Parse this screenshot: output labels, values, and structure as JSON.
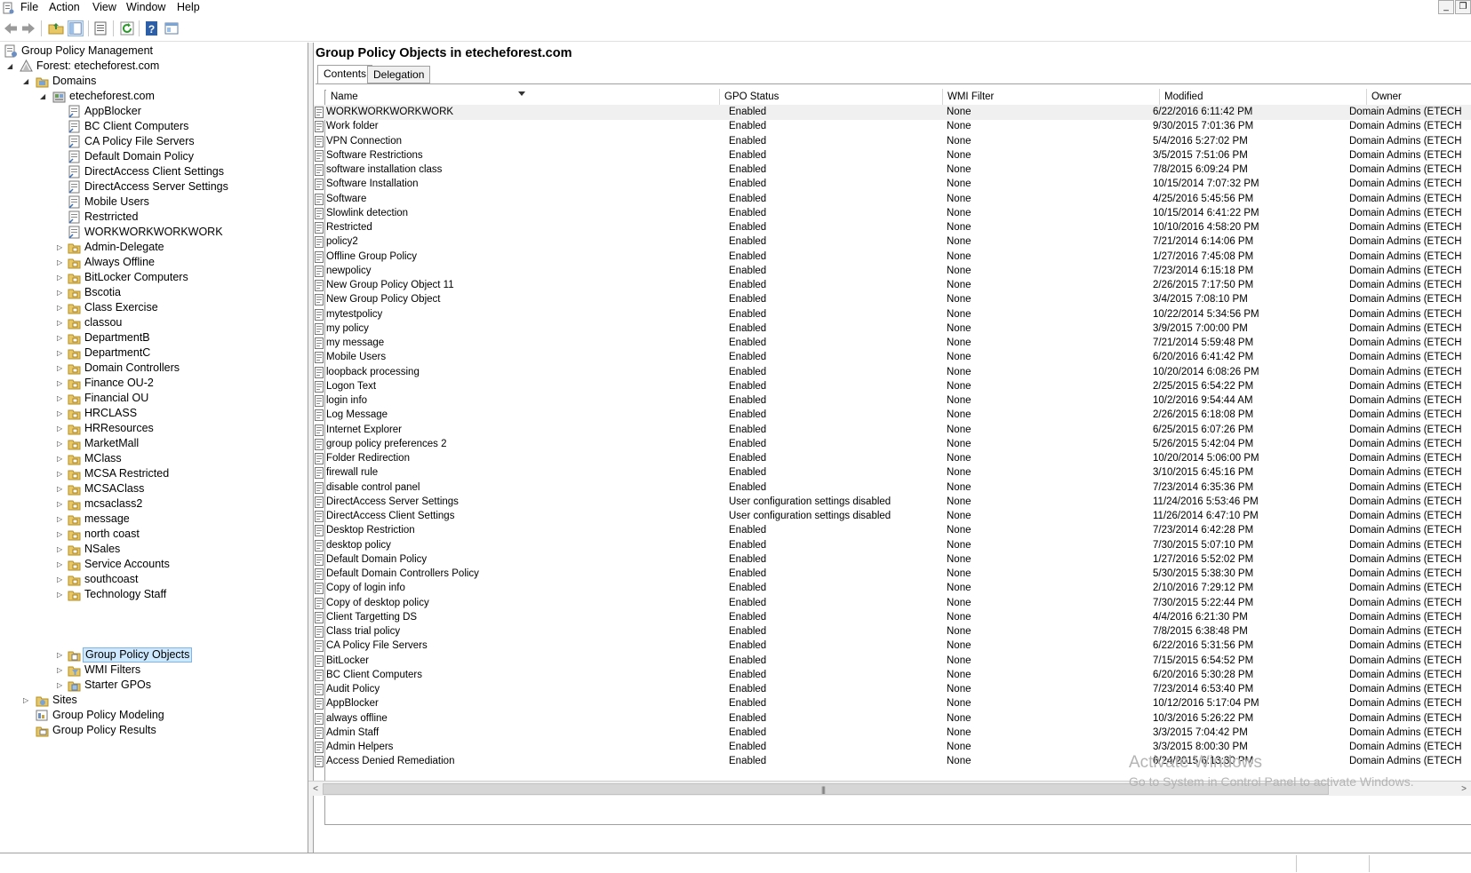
{
  "menu": {
    "items": [
      "File",
      "Action",
      "View",
      "Window",
      "Help"
    ]
  },
  "toolbar": {
    "icons": [
      "back-arrow-icon",
      "forward-arrow-icon",
      "up-folder-icon",
      "show-hide-tree-icon",
      "properties-icon",
      "refresh-icon",
      "help-icon",
      "console-view-icon"
    ]
  },
  "tree": {
    "root": "Group Policy Management",
    "forest": "Forest: etecheforest.com",
    "domains": "Domains",
    "domain": "etecheforest.com",
    "linked_gpos": [
      "AppBlocker",
      "BC Client Computers",
      "CA Policy File Servers",
      "Default Domain Policy",
      "DirectAccess Client Settings",
      "DirectAccess Server Settings",
      "Mobile Users",
      "Restrricted",
      "WORKWORKWORKWORK"
    ],
    "ous": [
      "Admin-Delegate",
      "Always Offline",
      "BitLocker Computers",
      "Bscotia",
      "Class Exercise",
      "classou",
      "DepartmentB",
      "DepartmentC",
      "Domain Controllers",
      "Finance OU-2",
      "Financial OU",
      "HRCLASS",
      "HRResources",
      "MarketMall",
      "MClass",
      "MCSA Restricted",
      "MCSAClass",
      "mcsaclass2",
      "message",
      "north coast",
      "NSales",
      "Service Accounts",
      "southcoast",
      "Technology Staff"
    ],
    "special": [
      "Group Policy Objects",
      "WMI Filters",
      "Starter GPOs"
    ],
    "sites": "Sites",
    "modeling": "Group Policy Modeling",
    "results": "Group Policy Results"
  },
  "main": {
    "title": "Group Policy Objects in etecheforest.com",
    "tabs": [
      "Contents",
      "Delegation"
    ],
    "columns": [
      "Name",
      "GPO Status",
      "WMI Filter",
      "Modified",
      "Owner"
    ],
    "rows": [
      [
        "WORKWORKWORKWORK",
        "Enabled",
        "None",
        "6/22/2016 6:11:42 PM",
        "Domain Admins (ETECH"
      ],
      [
        "Work folder",
        "Enabled",
        "None",
        "9/30/2015 7:01:36 PM",
        "Domain Admins (ETECH"
      ],
      [
        "VPN Connection",
        "Enabled",
        "None",
        "5/4/2016 5:27:02 PM",
        "Domain Admins (ETECH"
      ],
      [
        "Software Restrictions",
        "Enabled",
        "None",
        "3/5/2015 7:51:06 PM",
        "Domain Admins (ETECH"
      ],
      [
        "software installation class",
        "Enabled",
        "None",
        "7/8/2015 6:09:24 PM",
        "Domain Admins (ETECH"
      ],
      [
        "Software Installation",
        "Enabled",
        "None",
        "10/15/2014 7:07:32 PM",
        "Domain Admins (ETECH"
      ],
      [
        "Software",
        "Enabled",
        "None",
        "4/25/2016 5:45:56 PM",
        "Domain Admins (ETECH"
      ],
      [
        "Slowlink detection",
        "Enabled",
        "None",
        "10/15/2014 6:41:22 PM",
        "Domain Admins (ETECH"
      ],
      [
        "Restricted",
        "Enabled",
        "None",
        "10/10/2016 4:58:20 PM",
        "Domain Admins (ETECH"
      ],
      [
        "policy2",
        "Enabled",
        "None",
        "7/21/2014 6:14:06 PM",
        "Domain Admins (ETECH"
      ],
      [
        "Offline Group Policy",
        "Enabled",
        "None",
        "1/27/2016 7:45:08 PM",
        "Domain Admins (ETECH"
      ],
      [
        "newpolicy",
        "Enabled",
        "None",
        "7/23/2014 6:15:18 PM",
        "Domain Admins (ETECH"
      ],
      [
        "New Group Policy Object 11",
        "Enabled",
        "None",
        "2/26/2015 7:17:50 PM",
        "Domain Admins (ETECH"
      ],
      [
        "New Group Policy Object",
        "Enabled",
        "None",
        "3/4/2015 7:08:10 PM",
        "Domain Admins (ETECH"
      ],
      [
        "mytestpolicy",
        "Enabled",
        "None",
        "10/22/2014 5:34:56 PM",
        "Domain Admins (ETECH"
      ],
      [
        "my policy",
        "Enabled",
        "None",
        "3/9/2015 7:00:00 PM",
        "Domain Admins (ETECH"
      ],
      [
        "my message",
        "Enabled",
        "None",
        "7/21/2014 5:59:48 PM",
        "Domain Admins (ETECH"
      ],
      [
        "Mobile Users",
        "Enabled",
        "None",
        "6/20/2016 6:41:42 PM",
        "Domain Admins (ETECH"
      ],
      [
        "loopback processing",
        "Enabled",
        "None",
        "10/20/2014 6:08:26 PM",
        "Domain Admins (ETECH"
      ],
      [
        "Logon Text",
        "Enabled",
        "None",
        "2/25/2015 6:54:22 PM",
        "Domain Admins (ETECH"
      ],
      [
        "login info",
        "Enabled",
        "None",
        "10/2/2016 9:54:44 AM",
        "Domain Admins (ETECH"
      ],
      [
        "Log Message",
        "Enabled",
        "None",
        "2/26/2015 6:18:08 PM",
        "Domain Admins (ETECH"
      ],
      [
        "Internet Explorer",
        "Enabled",
        "None",
        "6/25/2015 6:07:26 PM",
        "Domain Admins (ETECH"
      ],
      [
        "group policy preferences 2",
        "Enabled",
        "None",
        "5/26/2015 5:42:04 PM",
        "Domain Admins (ETECH"
      ],
      [
        "Folder Redirection",
        "Enabled",
        "None",
        "10/20/2014 5:06:00 PM",
        "Domain Admins (ETECH"
      ],
      [
        "firewall rule",
        "Enabled",
        "None",
        "3/10/2015 6:45:16 PM",
        "Domain Admins (ETECH"
      ],
      [
        "disable control panel",
        "Enabled",
        "None",
        "7/23/2014 6:35:36 PM",
        "Domain Admins (ETECH"
      ],
      [
        "DirectAccess Server Settings",
        "User configuration settings disabled",
        "None",
        "11/24/2016 5:53:46 PM",
        "Domain Admins (ETECH"
      ],
      [
        "DirectAccess Client Settings",
        "User configuration settings disabled",
        "None",
        "11/26/2014 6:47:10 PM",
        "Domain Admins (ETECH"
      ],
      [
        "Desktop Restriction",
        "Enabled",
        "None",
        "7/23/2014 6:42:28 PM",
        "Domain Admins (ETECH"
      ],
      [
        "desktop policy",
        "Enabled",
        "None",
        "7/30/2015 5:07:10 PM",
        "Domain Admins (ETECH"
      ],
      [
        "Default Domain Policy",
        "Enabled",
        "None",
        "1/27/2016 5:52:02 PM",
        "Domain Admins (ETECH"
      ],
      [
        "Default Domain Controllers Policy",
        "Enabled",
        "None",
        "5/30/2015 5:38:30 PM",
        "Domain Admins (ETECH"
      ],
      [
        "Copy of login info",
        "Enabled",
        "None",
        "2/10/2016 7:29:12 PM",
        "Domain Admins (ETECH"
      ],
      [
        "Copy of desktop policy",
        "Enabled",
        "None",
        "7/30/2015 5:22:44 PM",
        "Domain Admins (ETECH"
      ],
      [
        "Client Targetting DS",
        "Enabled",
        "None",
        "4/4/2016 6:21:30 PM",
        "Domain Admins (ETECH"
      ],
      [
        "Class trial policy",
        "Enabled",
        "None",
        "7/8/2015 6:38:48 PM",
        "Domain Admins (ETECH"
      ],
      [
        "CA Policy File Servers",
        "Enabled",
        "None",
        "6/22/2016 5:31:56 PM",
        "Domain Admins (ETECH"
      ],
      [
        "BitLocker",
        "Enabled",
        "None",
        "7/15/2015 6:54:52 PM",
        "Domain Admins (ETECH"
      ],
      [
        "BC Client Computers",
        "Enabled",
        "None",
        "6/20/2016 5:30:28 PM",
        "Domain Admins (ETECH"
      ],
      [
        "Audit Policy",
        "Enabled",
        "None",
        "7/23/2014 6:53:40 PM",
        "Domain Admins (ETECH"
      ],
      [
        "AppBlocker",
        "Enabled",
        "None",
        "10/12/2016 5:17:04 PM",
        "Domain Admins (ETECH"
      ],
      [
        "always offline",
        "Enabled",
        "None",
        "10/3/2016 5:26:22 PM",
        "Domain Admins (ETECH"
      ],
      [
        "Admin Staff",
        "Enabled",
        "None",
        "3/3/2015 7:04:42 PM",
        "Domain Admins (ETECH"
      ],
      [
        "Admin Helpers",
        "Enabled",
        "None",
        "3/3/2015 8:00:30 PM",
        "Domain Admins (ETECH"
      ],
      [
        "Access Denied Remediation",
        "Enabled",
        "None",
        "6/24/2015 6:13:30 PM",
        "Domain Admins (ETECH"
      ]
    ]
  },
  "watermark": {
    "line1": "Activate Windows",
    "line2": "Go to System in Control Panel to activate Windows."
  }
}
